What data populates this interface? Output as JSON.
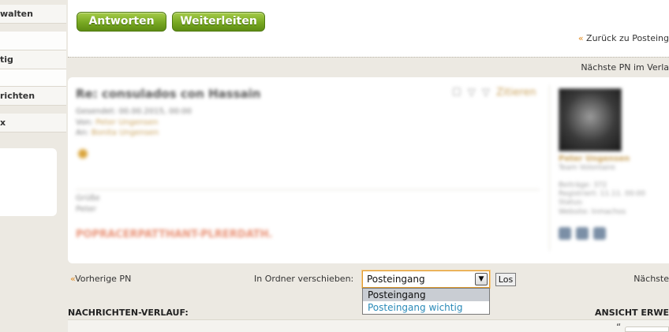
{
  "sidebar": {
    "items": [
      {
        "label": "walten"
      },
      {
        "label": "tig"
      },
      {
        "label": "richten"
      },
      {
        "label": "x"
      }
    ]
  },
  "actions": {
    "reply_label": "Antworten",
    "forward_label": "Weiterleiten"
  },
  "navigation": {
    "back_label": "Zurück zu Posteing",
    "next_top_label": "Nächste PN im Verla",
    "prev_label": "Vorherige PN",
    "next_bottom_label": "Nächste",
    "raquo": "«"
  },
  "message": {
    "title": "Re: consulados con Hassain",
    "meta_line1": "Gesendet: 00.00.2015, 00:00",
    "meta_from_label": "Von:",
    "meta_from": "Peter Ungensen",
    "meta_to_label": "An:",
    "meta_to": "Bonita Ungensen",
    "icons": "☐ ▽ ▽",
    "icons_extra": "Zitieren",
    "body_line1": "Grüße",
    "body_line2": "Peter",
    "signature": "POPRACERPATTHANT-PLRERDATH.",
    "sender_name": "Peter Ungensen",
    "sender_rank": "Team Volontaire",
    "sender_stat1": "Beiträge: 372",
    "sender_stat2": "Registriert: 11.11. 00:00",
    "sender_stat3": "Status:",
    "sender_stat4": "Website: Inmachos"
  },
  "move": {
    "label": "In Ordner verschieben:",
    "selected": "Posteingang",
    "options": [
      "Posteingang",
      "Posteingang wichtig"
    ],
    "submit_label": "Los",
    "arrow": "▼"
  },
  "history": {
    "title": "NACHRICHTEN-VERLAUF:",
    "view_label": "ANSICHT ERWE",
    "quote_mark": "“"
  },
  "colors": {
    "accent_orange": "#e08a1e",
    "button_green": "#78a822",
    "link_blue": "#2a8ab8",
    "page_bg": "#ece9e2"
  }
}
